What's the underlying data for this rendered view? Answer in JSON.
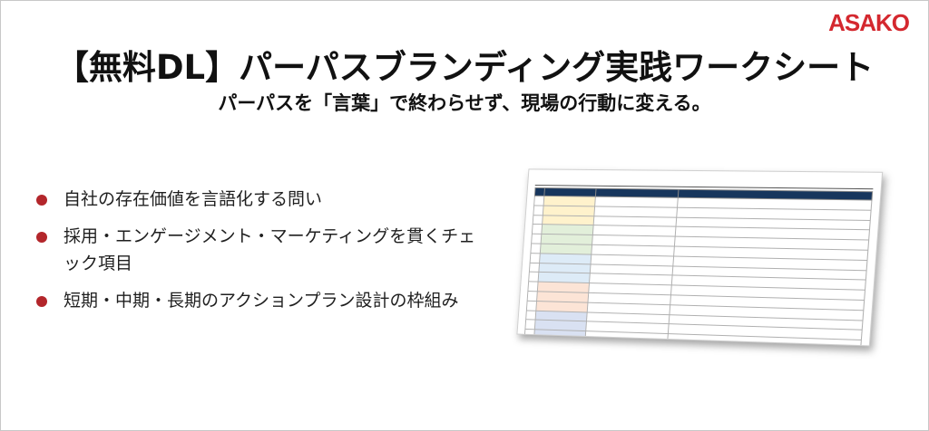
{
  "brand": "ASAKO",
  "title": "【無料DL】パーパスブランディング実践ワークシート",
  "subtitle": "パーパスを「言葉」で終わらせず、現場の行動に変える。",
  "bullets": [
    "自社の存在価値を言語化する問い",
    "採用・エンゲージメント・マーケティングを貫くチェック項目",
    "短期・中期・長期のアクションプラン設計の枠組み"
  ],
  "colors": {
    "brand": "#d4282f",
    "bullet": "#b3262b",
    "header_fill": "#17365d"
  }
}
